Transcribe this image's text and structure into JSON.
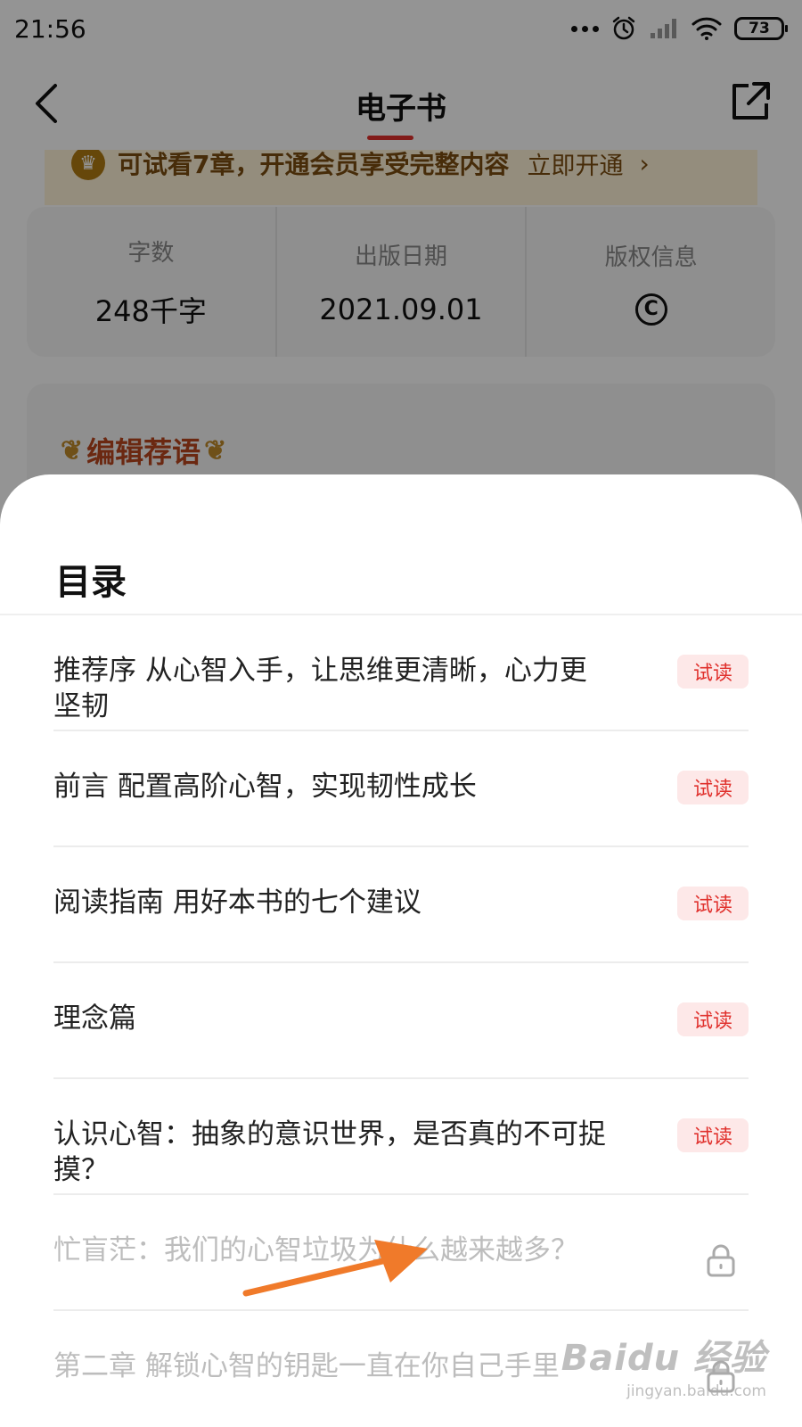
{
  "status_bar": {
    "time": "21:56",
    "battery": "73",
    "icons": [
      "more-dots-icon",
      "alarm-icon",
      "signal-icon",
      "wifi-icon",
      "battery-icon"
    ]
  },
  "nav": {
    "title": "电子书",
    "back_icon": "chevron-left-icon",
    "share_icon": "share-icon"
  },
  "vip_banner": {
    "text": "可试看7章，开通会员享受完整内容",
    "action": "立即开通",
    "chevron": "›"
  },
  "book_info": {
    "word_count_label": "字数",
    "word_count_value": "248千字",
    "publish_date_label": "出版日期",
    "publish_date_value": "2021.09.01",
    "copyright_label": "版权信息",
    "copyright_symbol": "C"
  },
  "editor": {
    "heading": "编辑荐语"
  },
  "toc": {
    "title": "目录",
    "items": [
      {
        "title": "推荐序 从心智入手，让思维更清晰，心力更坚韧",
        "badge": "试读"
      },
      {
        "title": "前言 配置高阶心智，实现韧性成长",
        "badge": "试读"
      },
      {
        "title": "阅读指南 用好本书的七个建议",
        "badge": "试读"
      },
      {
        "title": "理念篇",
        "badge": "试读"
      },
      {
        "title": "认识心智：抽象的意识世界，是否真的不可捉摸？",
        "badge": "试读"
      },
      {
        "title": "忙盲茫：我们的心智垃圾为什么越来越多？"
      },
      {
        "title": "第二章 解锁心智的钥匙一直在你自己手里"
      }
    ]
  },
  "watermark": {
    "main": "Baidu 经验",
    "sub": "jingyan.baidu.com"
  },
  "colors": {
    "accent": "#e0302c",
    "trial_badge_bg": "#fde8e8",
    "vip_banner_bg": "#fff3d8",
    "arrow": "#f07a2a",
    "locked_text": "#bdbdbd"
  }
}
